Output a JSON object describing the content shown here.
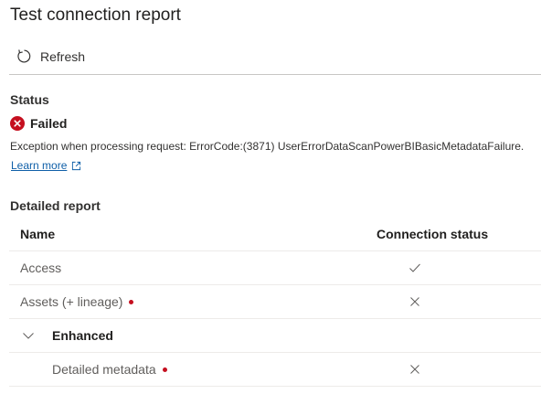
{
  "panel": {
    "title": "Test connection report"
  },
  "toolbar": {
    "refresh_label": "Refresh"
  },
  "status": {
    "label": "Status",
    "value": "Failed",
    "message": "Exception when processing request: ErrorCode:(3871) UserErrorDataScanPowerBIBasicMetadataFailure.",
    "learn_more": "Learn more"
  },
  "report": {
    "label": "Detailed report",
    "columns": {
      "name": "Name",
      "status": "Connection status"
    },
    "rows": [
      {
        "name": "Access",
        "status_icon": "checkmark-icon"
      },
      {
        "name": "Assets (+ lineage)",
        "status_icon": "x-icon",
        "required": true
      },
      {
        "name": "Enhanced",
        "group": true,
        "expanded": true
      },
      {
        "name": "Detailed metadata",
        "status_icon": "x-icon",
        "required": true
      }
    ]
  },
  "colors": {
    "error": "#c50f1f",
    "link": "#0f5fa8",
    "required_dot": "#c50f1f"
  }
}
